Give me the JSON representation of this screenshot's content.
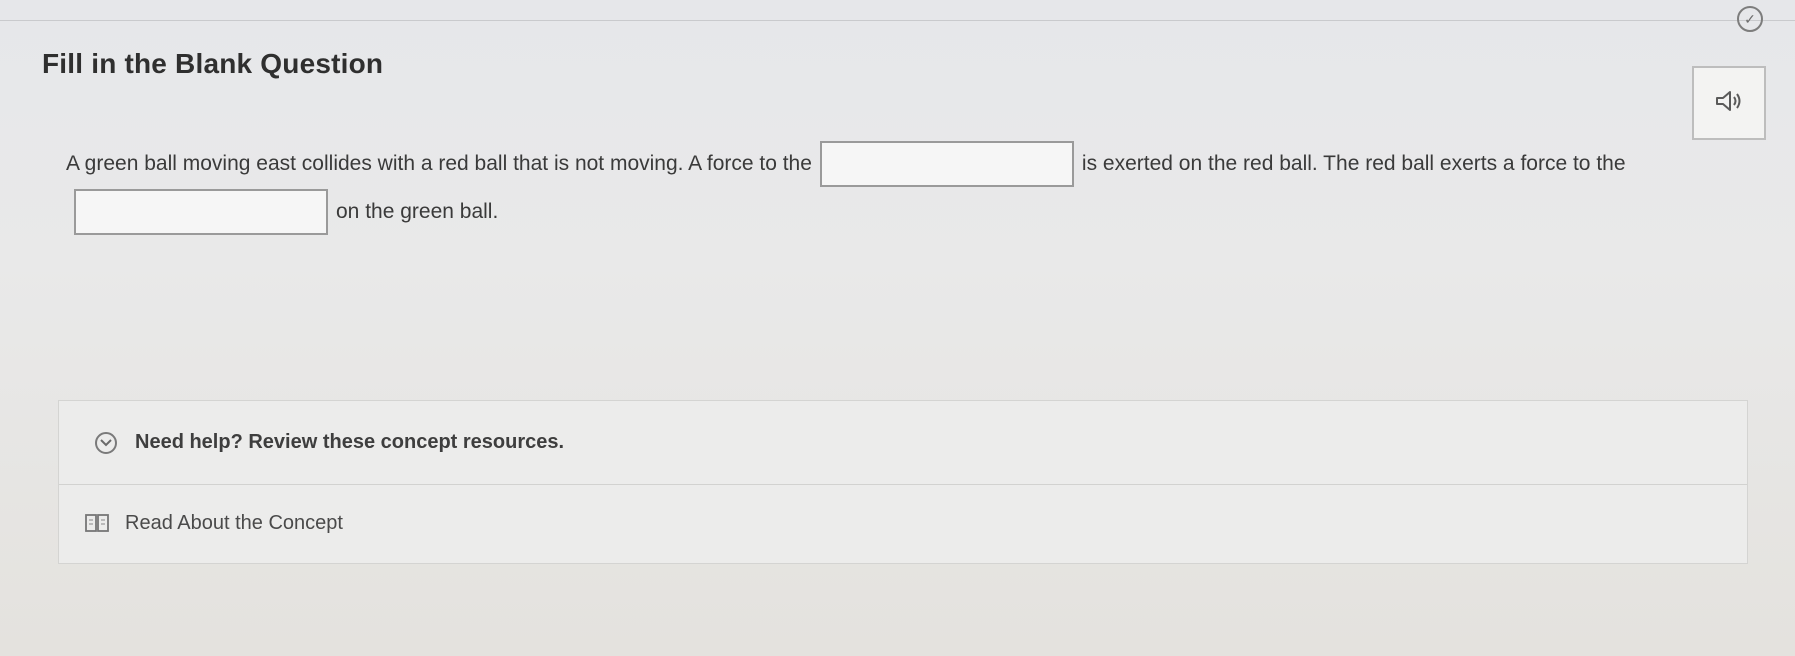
{
  "header": {
    "title": "Fill in the Blank Question",
    "status_icon": "check-circle-icon",
    "audio_icon": "speaker-icon"
  },
  "question": {
    "part1": "A green ball moving east collides with a red ball that is not moving. A force to the",
    "part2": "is exerted on the red ball. The red ball exerts a force to the",
    "part3": "on the green ball.",
    "blank1_value": "",
    "blank2_value": ""
  },
  "help": {
    "toggle_label": "Need help? Review these concept resources.",
    "toggle_icon": "chevron-down-icon",
    "resources": [
      {
        "label": "Read About the Concept",
        "icon": "book-icon"
      }
    ]
  }
}
